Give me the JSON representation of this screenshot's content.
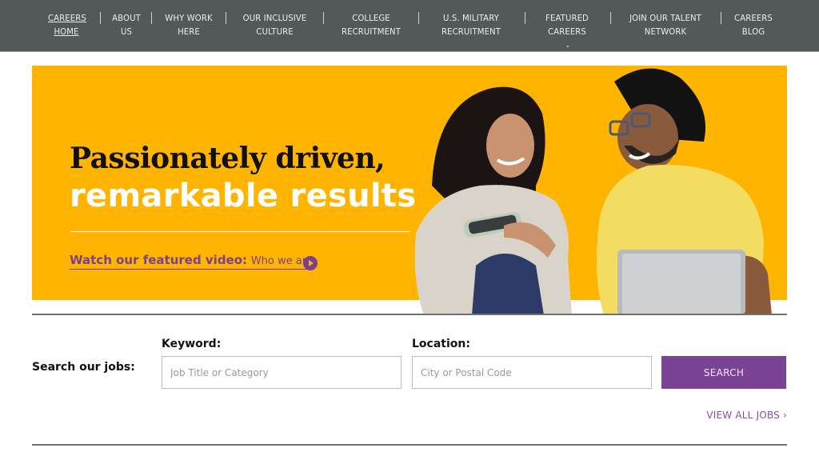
{
  "nav": {
    "items": [
      {
        "line1": "CAREERS",
        "line2": "HOME",
        "active": true
      },
      {
        "line1": "ABOUT",
        "line2": "US"
      },
      {
        "line1": "WHY WORK",
        "line2": "HERE"
      },
      {
        "line1": "OUR INCLUSIVE",
        "line2": "CULTURE"
      },
      {
        "line1": "COLLEGE",
        "line2": "RECRUITMENT"
      },
      {
        "line1": "U.S. MILITARY",
        "line2": "RECRUITMENT"
      },
      {
        "line1": "FEATURED",
        "line2": "CAREERS",
        "has_dropdown": true
      },
      {
        "line1": "JOIN OUR TALENT",
        "line2": "NETWORK"
      },
      {
        "line1": "CAREERS",
        "line2": "BLOG"
      }
    ],
    "dropdown_glyph": "⌄"
  },
  "hero": {
    "title_line1": "Passionately driven,",
    "title_line2": "remarkable results",
    "video_lead": "Watch our featured video:",
    "video_title": "Who we are",
    "play_icon": "play-circle-icon",
    "background_color": "#ffb500",
    "accent_color": "#7b3f91"
  },
  "search": {
    "heading": "Search our jobs:",
    "keyword_label": "Keyword:",
    "keyword_placeholder": "Job Title or Category",
    "keyword_value": "",
    "location_label": "Location:",
    "location_placeholder": "City or Postal Code",
    "location_value": "",
    "button_label": "SEARCH",
    "button_color": "#7b4393",
    "view_all_label": "VIEW ALL JOBS ›"
  }
}
